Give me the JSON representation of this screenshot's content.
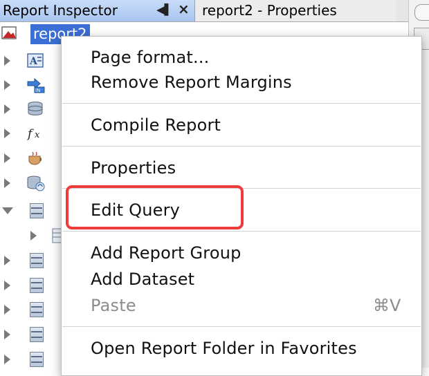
{
  "tabs": {
    "active": {
      "title": "Report Inspector",
      "minimize_icon": "pin-icon",
      "close_icon": "close-icon"
    },
    "inactive": {
      "title": "report2 - Properties"
    }
  },
  "tree": {
    "root_label": "report2",
    "nodes": [
      {
        "icon": "styles-icon",
        "expanded": false
      },
      {
        "icon": "parameters-icon",
        "expanded": false
      },
      {
        "icon": "fields-icon",
        "expanded": false
      },
      {
        "icon": "variables-icon",
        "expanded": false
      },
      {
        "icon": "scriptlets-icon",
        "expanded": false
      },
      {
        "icon": "subdatasets-icon",
        "expanded": false
      },
      {
        "icon": "band-icon",
        "expanded": true
      },
      {
        "icon": "element-icon",
        "expanded": false
      },
      {
        "icon": "band-icon",
        "expanded": false
      },
      {
        "icon": "band-icon",
        "expanded": false
      },
      {
        "icon": "band-icon",
        "expanded": false
      },
      {
        "icon": "band-icon",
        "expanded": false
      },
      {
        "icon": "band-icon",
        "expanded": false
      }
    ]
  },
  "context_menu": {
    "page_format": "Page format...",
    "remove_margins": "Remove Report Margins",
    "compile_report": "Compile Report",
    "properties": "Properties",
    "edit_query": "Edit Query",
    "add_report_group": "Add Report Group",
    "add_dataset": "Add Dataset",
    "paste": "Paste",
    "paste_shortcut": "⌘V",
    "open_folder_favorites": "Open Report Folder in Favorites"
  },
  "colors": {
    "selection": "#3b6fd6",
    "highlight_box": "#ef3b3b",
    "active_tab": "#b6cff5"
  }
}
